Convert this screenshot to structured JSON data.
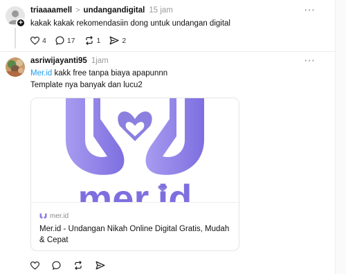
{
  "post1": {
    "username": "triaaaamell",
    "chevron": ">",
    "community": "undangandigital",
    "time": "15 jam",
    "more": "···",
    "text": "kakak kakak rekomendasiin dong untuk undangan digital",
    "actions": {
      "likes": "4",
      "replies": "17",
      "reposts": "1",
      "shares": "2"
    }
  },
  "post2": {
    "username": "asriwijayanti95",
    "time": "1jam",
    "more": "···",
    "link_text": "Mer.id",
    "line1_rest": " kakk free tanpa biaya apapunnn",
    "line2": "Template nya banyak dan lucu2",
    "card": {
      "logo_text": "mer.id",
      "domain": "mer.id",
      "title": "Mer.id - Undangan Nikah Online Digital Gratis, Mudah & Cepat",
      "accent": "#8b7fe0"
    }
  },
  "colors": {
    "link": "#1d9bf0",
    "muted": "#999999",
    "brand_purple": "#8b7fe0"
  }
}
